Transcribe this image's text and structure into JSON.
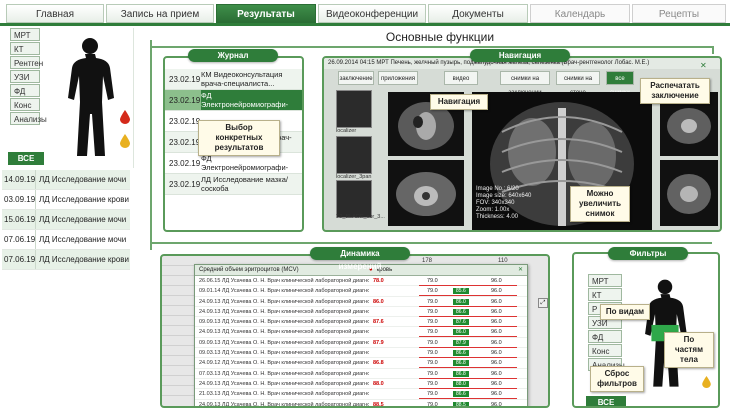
{
  "tabs": [
    {
      "label": "Главная",
      "state": "normal"
    },
    {
      "label": "Запись на прием",
      "state": "normal"
    },
    {
      "label": "Результаты",
      "state": "active"
    },
    {
      "label": "Видеоконференции",
      "state": "normal"
    },
    {
      "label": "Документы",
      "state": "normal"
    },
    {
      "label": "Календарь",
      "state": "disabled"
    },
    {
      "label": "Рецепты",
      "state": "disabled"
    }
  ],
  "left_panel": {
    "categories": [
      "МРТ",
      "КТ",
      "Рентген",
      "УЗИ",
      "ФД",
      "Конс",
      "Анализы"
    ],
    "all_label": "ВСЕ"
  },
  "visits": [
    {
      "date": "14.09.19",
      "text": "ЛД Исследование мочи"
    },
    {
      "date": "03.09.19",
      "text": "ЛД Исследование крови"
    },
    {
      "date": "15.06.19",
      "text": "ЛД Исследование мочи"
    },
    {
      "date": "07.06.19",
      "text": "ЛД Исследование мочи"
    },
    {
      "date": "07.06.19",
      "text": "ЛД Исследование крови"
    }
  ],
  "main_title": "Основные функции",
  "journal": {
    "label": "Журнал",
    "rows": [
      {
        "date": "23.02.19",
        "text": "КМ Видеоконсультация врача-специалиста...",
        "style": "alt"
      },
      {
        "date": "23.02.19",
        "text": "ФД Электронейромиографи-фия (ЭНМГ) (Врач ФД...",
        "style": "sel"
      },
      {
        "date": "23.02.19",
        "text": "",
        "style": "plain"
      },
      {
        "date": "23.02.19",
        "text": "МРТ Стопа (левая) (Врач-рентгенолог Лобас...",
        "style": "alt"
      },
      {
        "date": "23.02.19",
        "text": "ФД Электронейромиографи-фия (ЭНМГ) (Врач ФД...",
        "style": "plain"
      },
      {
        "date": "23.02.19",
        "text": "ЛД Исследование мазка/соскоба",
        "style": "alt"
      }
    ]
  },
  "navigation": {
    "label": "Навигация",
    "header": "26.09.2014 04:15 МРТ Печень, желчный пузырь, поджелудочная железа, селезенка (Врач-рентгенолог Лобас. М.Е.)",
    "tools": [
      "заключение",
      "приложения",
      "видео",
      "снимки на заключении",
      "снимки на стене",
      "все снимки"
    ],
    "thumb_captions": [
      "localizer",
      "localizer_3pan",
      "T2_BLADE_cor_3..."
    ],
    "scan_info": "Image No.: 6/20\nImage size: 640x640\nFOV: 340x340\nZoom: 1.00x\nThickness: 4.00"
  },
  "dynamics": {
    "label": "Динамика измерений",
    "window_title": "Средний объем эритроцитов (MCV)",
    "column_header": "кровь",
    "top_values": [
      "178",
      "110"
    ],
    "rows": [
      {
        "text": "26.06.15 ЛД Усачева О. Н. Врач клинической лабораторной диагностики Медзоклрет",
        "red": "78.0",
        "v1": "79.0",
        "badge": "",
        "v2": "96.0"
      },
      {
        "text": "09.01.14 ЛД Усачева О. Н. Врач клинической лабораторной диагностики Медзоклрет",
        "red": "",
        "v1": "79.0",
        "badge": "85.6",
        "v2": "96.0"
      },
      {
        "text": "24.09.13 ЛД Усачева О. Н. Врач клинической лабораторной диагностики Медзоклрет",
        "red": "86.0",
        "v1": "79.0",
        "badge": "86.0",
        "v2": "96.0"
      },
      {
        "text": "24.09.13 ЛД Усачева О. Н. Врач клинической лабораторной диагностики Медзоклрет",
        "red": "",
        "v1": "79.0",
        "badge": "86.6",
        "v2": "96.0"
      },
      {
        "text": "09.09.13 ЛД Усачева О. Н. Врач клинической лабораторной диагностики Медзоклрет",
        "red": "87.6",
        "v1": "79.0",
        "badge": "87.6",
        "v2": "96.0"
      },
      {
        "text": "24.09.13 ЛД Усачева О. Н. Врач клинической лабораторной диагностики Медзоклрет",
        "red": "",
        "v1": "79.0",
        "badge": "86.0",
        "v2": "96.0"
      },
      {
        "text": "09.09.13 ЛД Усачева О. Н. Врач клинической лабораторной диагностики Медзоклрет",
        "red": "87.9",
        "v1": "79.0",
        "badge": "87.9",
        "v2": "96.0"
      },
      {
        "text": "09.03.13 ЛД Усачева О. Н. Врач клинической лабораторной диагностики Медзоклрет",
        "red": "",
        "v1": "79.0",
        "badge": "86.6",
        "v2": "96.0"
      },
      {
        "text": "24.09.12 ЛД Усачева О. Н. Врач клинической лабораторной диагностики Медзоклрет",
        "red": "86.8",
        "v1": "79.0",
        "badge": "86.8",
        "v2": "96.0"
      },
      {
        "text": "07.03.13 ЛД Усачева О. Н. Врач клинической лабораторной диагностики Медзоклрет",
        "red": "",
        "v1": "79.0",
        "badge": "86.8",
        "v2": "96.0"
      },
      {
        "text": "24.09.13 ЛД Усачева О. Н. Врач клинической лабораторной диагностики Медзоклрет",
        "red": "88.0",
        "v1": "79.0",
        "badge": "88.0",
        "v2": "96.0"
      },
      {
        "text": "21.03.13 ЛД Усачева О. Н. Врач клинической лабораторной диагностики Медзоклрет",
        "red": "",
        "v1": "79.0",
        "badge": "86.6",
        "v2": "96.0"
      },
      {
        "text": "24.09.13 ЛД Усачева О. Н. Врач клинической лабораторной диагностики Медзоклрет",
        "red": "88.5",
        "v1": "79.0",
        "badge": "88.5",
        "v2": "96.0"
      }
    ]
  },
  "filters": {
    "label": "Фильтры",
    "buttons": [
      "МРТ",
      "КТ",
      "Р",
      "УЗИ",
      "ФД",
      "Конс",
      "Анализы"
    ],
    "all_label": "ВСЕ"
  },
  "callouts": {
    "selection": "Выбор конкретных результатов",
    "navigation": "Навигация",
    "print": "Распечатать заключение",
    "zoom": "Можно увеличить снимок",
    "by_type": "По видам",
    "by_body": "По частям тела",
    "reset": "Сброс фильтров"
  },
  "colors": {
    "brand": "#2f7d3a",
    "highlight": "#8cbf8c",
    "alert": "#cc0000",
    "blood_drop": "#d42a1a",
    "urine_drop": "#e8b020"
  }
}
